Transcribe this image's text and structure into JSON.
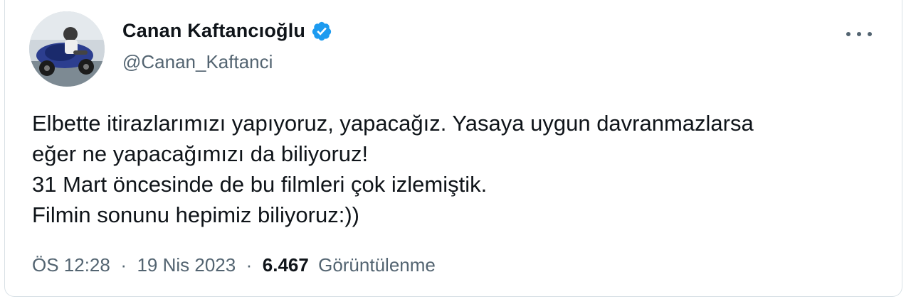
{
  "author": {
    "display_name": "Canan Kaftancıoğlu",
    "handle": "@Canan_Kaftanci",
    "verified": true,
    "verified_color": "#1d9bf0"
  },
  "tweet": {
    "lines": [
      "Elbette itirazlarımızı yapıyoruz, yapacağız. Yasaya uygun davranmazlarsa",
      "eğer ne yapacağımızı da biliyoruz!",
      "31 Mart öncesinde de bu filmleri çok izlemiştik.",
      "Filmin sonunu hepimiz biliyoruz:))"
    ]
  },
  "meta": {
    "time": "ÖS 12:28",
    "separator": "·",
    "date": "19 Nis 2023",
    "views_count": "6.467",
    "views_label": "Görüntülenme"
  },
  "colors": {
    "text_primary": "#0f1419",
    "text_secondary": "#536471",
    "border": "#d9e1e6"
  },
  "icons": {
    "more": "more-dots-icon",
    "verified": "verified-badge-icon"
  }
}
